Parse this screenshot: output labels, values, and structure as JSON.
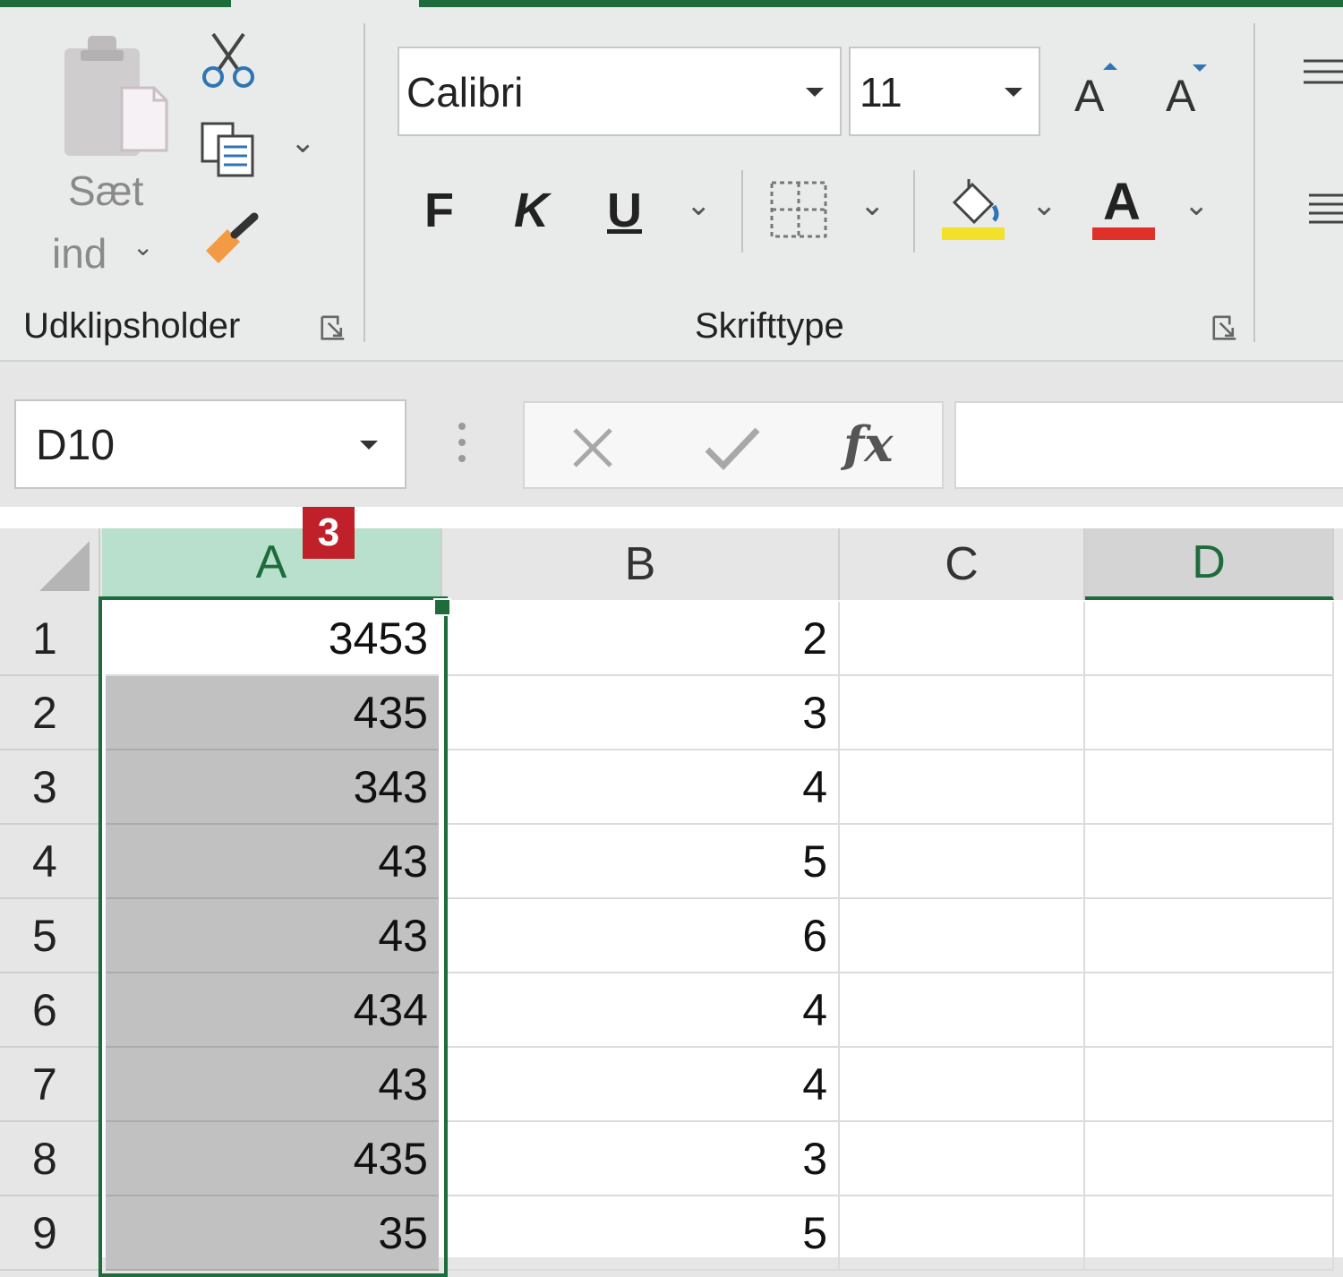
{
  "clipboard": {
    "paste_label_line1": "Sæt",
    "paste_label_line2": "ind",
    "group_label": "Udklipsholder"
  },
  "font": {
    "font_name": "Calibri",
    "font_size": "11",
    "bold_label": "F",
    "italic_label": "K",
    "underline_label": "U",
    "grow_label": "A",
    "shrink_label": "A",
    "font_color_label": "A",
    "group_label": "Skrifttype",
    "fill_color": "#f2e02a",
    "font_color": "#e0302a"
  },
  "formula_bar": {
    "name_box": "D10",
    "fx_label": "fx",
    "formula_value": ""
  },
  "sheet": {
    "columns": [
      "A",
      "B",
      "C",
      "D"
    ],
    "badge": "3",
    "rows": [
      {
        "num": "1",
        "a": "3453",
        "b": "2"
      },
      {
        "num": "2",
        "a": "435",
        "b": "3"
      },
      {
        "num": "3",
        "a": "343",
        "b": "4"
      },
      {
        "num": "4",
        "a": "43",
        "b": "5"
      },
      {
        "num": "5",
        "a": "43",
        "b": "6"
      },
      {
        "num": "6",
        "a": "434",
        "b": "4"
      },
      {
        "num": "7",
        "a": "43",
        "b": "4"
      },
      {
        "num": "8",
        "a": "435",
        "b": "3"
      },
      {
        "num": "9",
        "a": "35",
        "b": "5"
      }
    ]
  },
  "colors": {
    "accent_green": "#1e6b3b",
    "selected_header": "#b8e0cc",
    "badge_red": "#c0202a"
  }
}
